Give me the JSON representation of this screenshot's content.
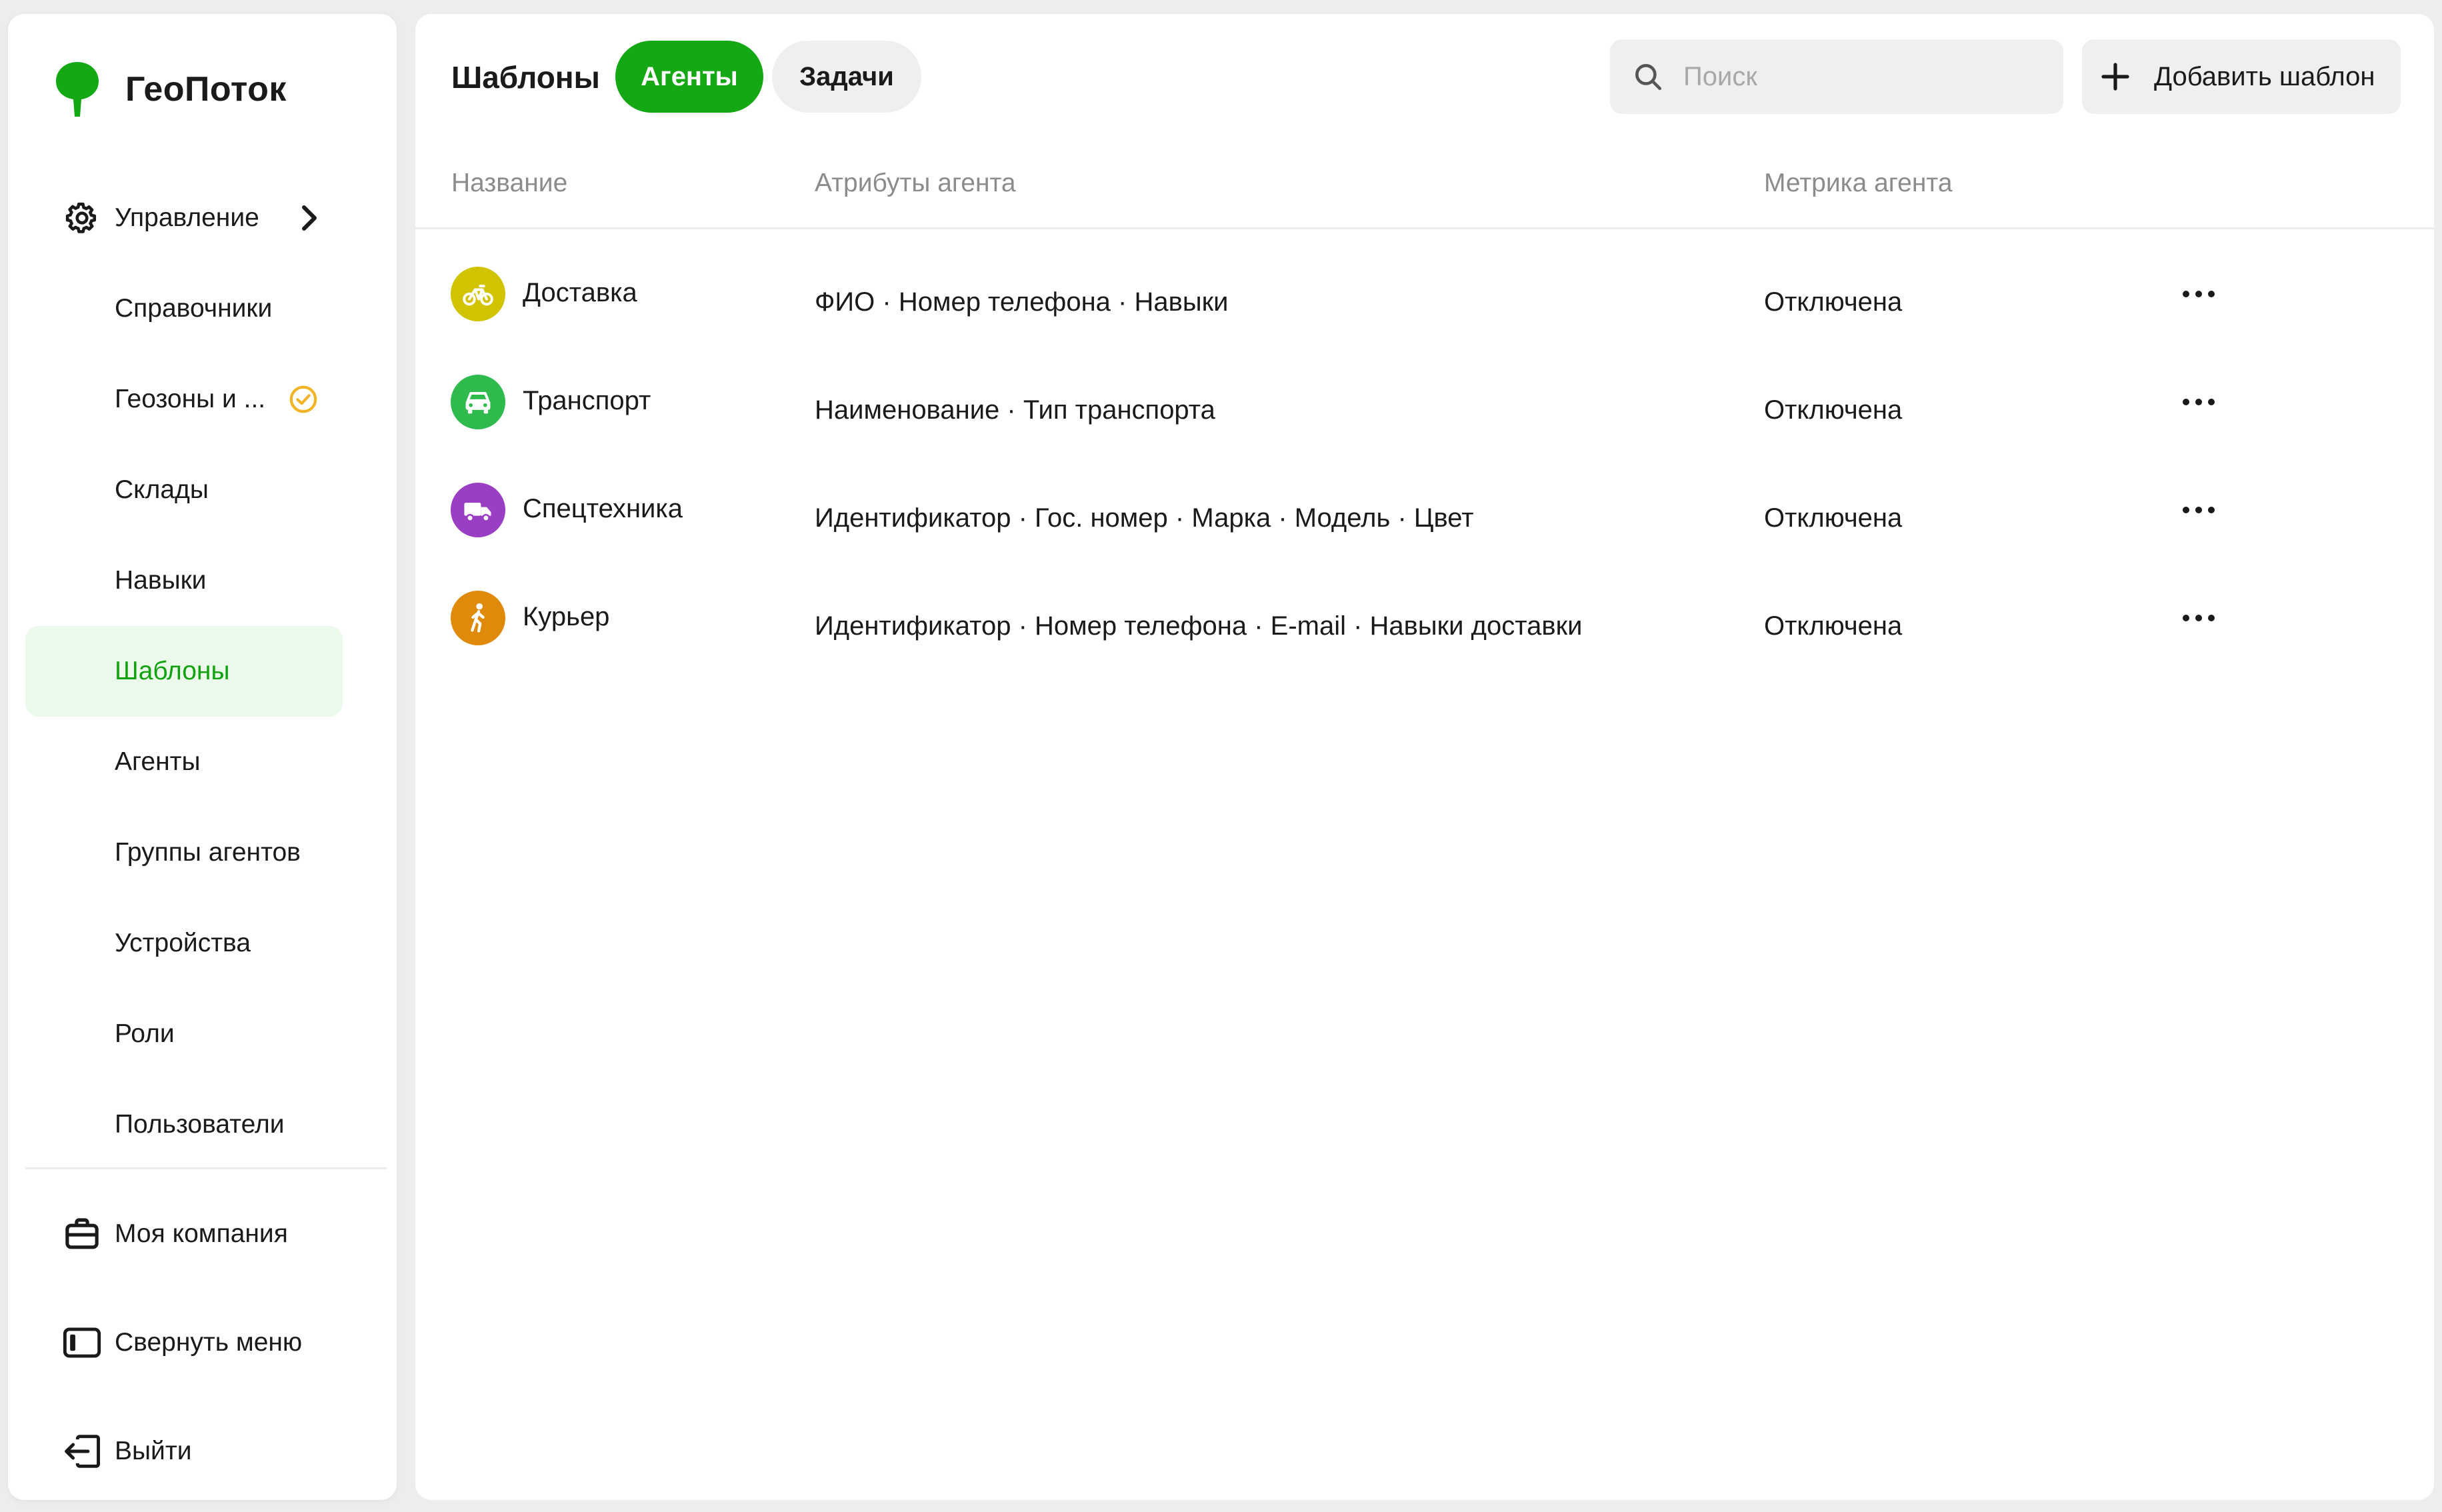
{
  "app": {
    "name": "ГеоПоток"
  },
  "colors": {
    "accent": "#14a914",
    "active_bg": "#ecfaec",
    "warning": "#f2b324"
  },
  "sidebar": {
    "management": {
      "label": "Управление",
      "icon": "gear-icon"
    },
    "items": [
      {
        "label": "Справочники"
      },
      {
        "label": "Геозоны и ...",
        "badge": "check-circle-icon"
      },
      {
        "label": "Склады"
      },
      {
        "label": "Навыки"
      },
      {
        "label": "Шаблоны",
        "active": true
      },
      {
        "label": "Агенты"
      },
      {
        "label": "Группы агентов"
      },
      {
        "label": "Устройства"
      },
      {
        "label": "Роли"
      },
      {
        "label": "Пользователи"
      }
    ],
    "bottom": [
      {
        "label": "Моя компания",
        "icon": "briefcase-icon"
      },
      {
        "label": "Свернуть меню",
        "icon": "collapse-sidebar-icon"
      },
      {
        "label": "Выйти",
        "icon": "logout-icon"
      }
    ]
  },
  "main": {
    "title": "Шаблоны",
    "tabs": [
      {
        "label": "Агенты",
        "active": true
      },
      {
        "label": "Задачи",
        "active": false
      }
    ],
    "search": {
      "placeholder": "Поиск",
      "value": ""
    },
    "add_button": {
      "label": "Добавить шаблон"
    },
    "columns": {
      "name": "Название",
      "attrs": "Атрибуты агента",
      "metric": "Метрика агента"
    },
    "rows": [
      {
        "name": "Доставка",
        "attrs": "ФИО · Номер телефона · Навыки",
        "metric": "Отключена",
        "icon": "bicycle-icon",
        "color": "#d2c300"
      },
      {
        "name": "Транспорт",
        "attrs": "Наименование · Тип транспорта",
        "metric": "Отключена",
        "icon": "car-icon",
        "color": "#2fba4d"
      },
      {
        "name": "Спецтехника",
        "attrs": "Идентификатор · Гос. номер · Марка · Модель · Цвет",
        "metric": "Отключена",
        "icon": "truck-icon",
        "color": "#9a3fc4"
      },
      {
        "name": "Курьер",
        "attrs": "Идентификатор · Номер телефона · E-mail · Навыки доставки",
        "metric": "Отключена",
        "icon": "walking-person-icon",
        "color": "#e08a0b"
      }
    ]
  }
}
